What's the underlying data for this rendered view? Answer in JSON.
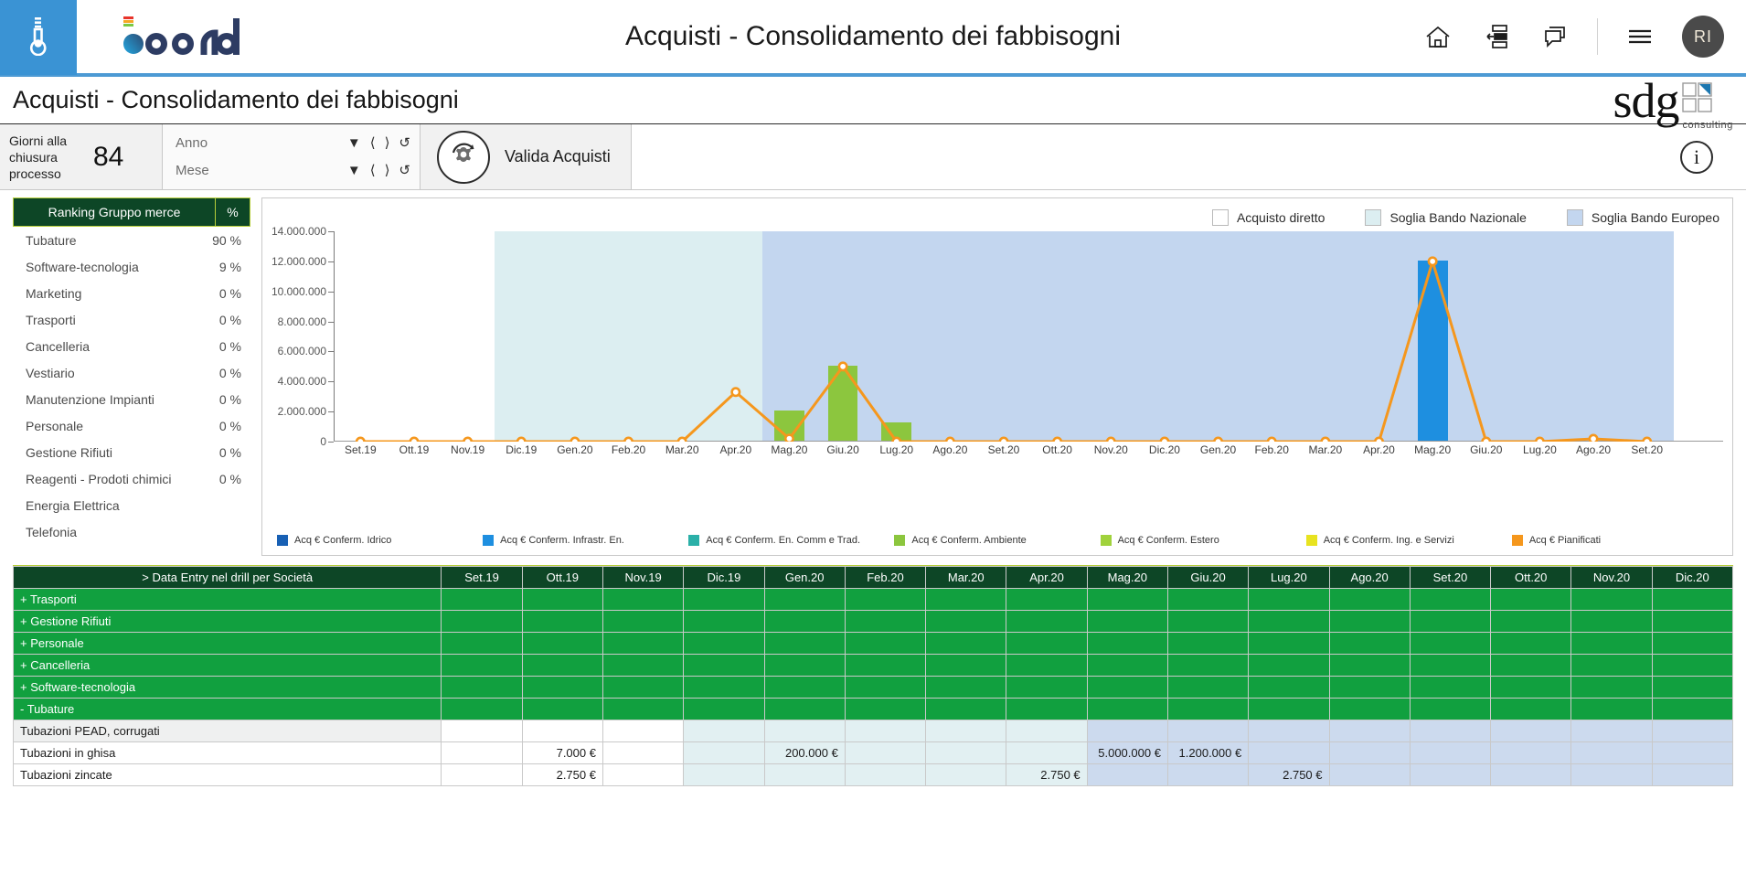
{
  "topbar": {
    "app_title": "Acquisti - Consolidamento dei fabbisogni",
    "brand": "board",
    "icons": [
      "home-icon",
      "layout-icon",
      "comments-icon",
      "hamburger-menu-icon"
    ],
    "avatar_initials": "RI"
  },
  "page_header": {
    "title": "Acquisti - Consolidamento dei fabbisogni",
    "logo_word": "sdg",
    "logo_sub": "consulting"
  },
  "filterbar": {
    "kpi_label": "Giorni alla chiusura processo",
    "kpi_value": "84",
    "selectors": [
      {
        "label": "Anno",
        "value": ""
      },
      {
        "label": "Mese",
        "value": ""
      }
    ],
    "validate_label": "Valida Acquisti",
    "info_glyph": "i"
  },
  "ranking": {
    "header_name": "Ranking Gruppo merce",
    "header_pct": "%",
    "rows": [
      {
        "name": "Tubature",
        "pct": "90 %"
      },
      {
        "name": "Software-tecnologia",
        "pct": "9 %"
      },
      {
        "name": "Marketing",
        "pct": "0 %"
      },
      {
        "name": "Trasporti",
        "pct": "0 %"
      },
      {
        "name": "Cancelleria",
        "pct": "0 %"
      },
      {
        "name": "Vestiario",
        "pct": "0 %"
      },
      {
        "name": "Manutenzione Impianti",
        "pct": "0 %"
      },
      {
        "name": "Personale",
        "pct": "0 %"
      },
      {
        "name": "Gestione Rifiuti",
        "pct": "0 %"
      },
      {
        "name": "Reagenti - Prodoti chimici",
        "pct": "0 %"
      },
      {
        "name": "Energia Elettrica",
        "pct": ""
      },
      {
        "name": "Telefonia",
        "pct": ""
      }
    ]
  },
  "chart_data": {
    "type": "bar",
    "title": "",
    "xlabel": "",
    "ylabel": "",
    "ylim": [
      0,
      14000000
    ],
    "ytick_labels": [
      "0",
      "2.000.000",
      "4.000.000",
      "6.000.000",
      "8.000.000",
      "10.000.000",
      "12.000.000",
      "14.000.000"
    ],
    "ytick_values": [
      0,
      2000000,
      4000000,
      6000000,
      8000000,
      10000000,
      12000000,
      14000000
    ],
    "grid": false,
    "legend_position": "bottom",
    "categories": [
      "Set.19",
      "Ott.19",
      "Nov.19",
      "Dic.19",
      "Gen.20",
      "Feb.20",
      "Mar.20",
      "Apr.20",
      "Mag.20",
      "Giu.20",
      "Lug.20",
      "Ago.20",
      "Set.20",
      "Ott.20",
      "Nov.20",
      "Dic.20",
      "Gen.20",
      "Feb.20",
      "Mar.20",
      "Apr.20",
      "Mag.20",
      "Giu.20",
      "Lug.20",
      "Ago.20",
      "Set.20"
    ],
    "legend_top": [
      {
        "label": "Acquisto diretto",
        "color": "#ffffff"
      },
      {
        "label": "Soglia Bando Nazionale",
        "color": "#dceef1"
      },
      {
        "label": "Soglia Bando Europeo",
        "color": "#c3d6ef"
      }
    ],
    "series": [
      {
        "name": "Acq € Conferm. Idrico",
        "color": "#1860b4",
        "values": [
          0,
          0,
          0,
          0,
          0,
          0,
          0,
          0,
          0,
          0,
          0,
          0,
          0,
          0,
          0,
          0,
          0,
          0,
          0,
          0,
          0,
          0,
          0,
          0,
          0
        ]
      },
      {
        "name": "Acq € Conferm. Infrastr. En.",
        "color": "#1e8fe0",
        "values": [
          0,
          0,
          0,
          0,
          0,
          0,
          0,
          0,
          0,
          0,
          0,
          0,
          0,
          0,
          0,
          0,
          0,
          0,
          0,
          0,
          12000000,
          0,
          0,
          0,
          0
        ]
      },
      {
        "name": "Acq € Conferm. En. Comm e Trad.",
        "color": "#2bb0a8",
        "values": [
          0,
          0,
          0,
          0,
          0,
          0,
          0,
          0,
          0,
          0,
          0,
          0,
          0,
          0,
          0,
          0,
          0,
          0,
          0,
          0,
          0,
          0,
          0,
          0,
          0
        ]
      },
      {
        "name": "Acq € Conferm. Ambiente",
        "color": "#8cc63e",
        "values": [
          0,
          0,
          0,
          0,
          0,
          0,
          0,
          0,
          2000000,
          5000000,
          1200000,
          0,
          0,
          0,
          0,
          0,
          0,
          0,
          0,
          0,
          0,
          0,
          0,
          0,
          0
        ]
      },
      {
        "name": "Acq € Conferm. Estero",
        "color": "#a0d23c",
        "values": [
          0,
          0,
          0,
          0,
          0,
          0,
          0,
          0,
          0,
          0,
          0,
          0,
          0,
          0,
          0,
          0,
          0,
          0,
          0,
          0,
          0,
          0,
          0,
          0,
          0
        ]
      },
      {
        "name": "Acq € Conferm. Ing. e Servizi",
        "color": "#e8e320",
        "values": [
          0,
          0,
          0,
          0,
          0,
          0,
          0,
          0,
          0,
          0,
          0,
          0,
          0,
          0,
          0,
          0,
          0,
          0,
          0,
          0,
          0,
          0,
          0,
          0,
          0
        ]
      },
      {
        "name": "Acq € Pianificati",
        "color": "#f5971d",
        "kind": "line",
        "values": [
          0,
          0,
          0,
          0,
          0,
          0,
          0,
          3300000,
          200000,
          5000000,
          0,
          0,
          0,
          0,
          0,
          0,
          0,
          0,
          0,
          0,
          12000000,
          0,
          0,
          180000,
          0
        ]
      }
    ],
    "bands": [
      {
        "name": "Soglia Bando Nazionale",
        "color": "#dceef1",
        "from_index": 3,
        "to_index": 7
      },
      {
        "name": "Soglia Bando Europeo",
        "color": "#c3d6ef",
        "from_index": 8,
        "to_index": 24
      }
    ]
  },
  "grid": {
    "header_first": "> Data Entry nel drill per Società",
    "columns": [
      "Set.19",
      "Ott.19",
      "Nov.19",
      "Dic.19",
      "Gen.20",
      "Feb.20",
      "Mar.20",
      "Apr.20",
      "Mag.20",
      "Giu.20",
      "Lug.20",
      "Ago.20",
      "Set.20",
      "Ott.20",
      "Nov.20",
      "Dic.20"
    ],
    "rows": [
      {
        "type": "group",
        "label": "+ Trasporti",
        "cells": [
          "",
          "",
          "",
          "",
          "",
          "",
          "",
          "",
          "",
          "",
          "",
          "",
          "",
          "",
          "",
          ""
        ]
      },
      {
        "type": "group",
        "label": "+ Gestione Rifiuti",
        "cells": [
          "",
          "",
          "",
          "",
          "",
          "",
          "",
          "",
          "",
          "",
          "",
          "",
          "",
          "",
          "",
          ""
        ]
      },
      {
        "type": "group",
        "label": "+ Personale",
        "cells": [
          "",
          "",
          "",
          "",
          "",
          "",
          "",
          "",
          "",
          "",
          "",
          "",
          "",
          "",
          "",
          ""
        ]
      },
      {
        "type": "group",
        "label": "+ Cancelleria",
        "cells": [
          "",
          "",
          "",
          "",
          "",
          "",
          "",
          "",
          "",
          "",
          "",
          "",
          "",
          "",
          "",
          ""
        ]
      },
      {
        "type": "group",
        "label": "+ Software-tecnologia",
        "cells": [
          "",
          "",
          "",
          "",
          "",
          "",
          "",
          "",
          "",
          "",
          "",
          "",
          "",
          "",
          "",
          ""
        ]
      },
      {
        "type": "group",
        "label": "- Tubature",
        "cells": [
          "",
          "",
          "",
          "",
          "",
          "",
          "",
          "",
          "",
          "",
          "",
          "",
          "",
          "",
          "",
          ""
        ]
      },
      {
        "type": "leaf",
        "alt": true,
        "label": "Tubazioni PEAD, corrugati",
        "cells": [
          "",
          "",
          "",
          "",
          "",
          "",
          "",
          "",
          "",
          "",
          "",
          "",
          "",
          "",
          "",
          ""
        ]
      },
      {
        "type": "leaf",
        "alt": false,
        "label": "Tubazioni in ghisa",
        "cells": [
          "",
          "7.000 €",
          "",
          "",
          "200.000 €",
          "",
          "",
          "",
          "5.000.000 €",
          "1.200.000 €",
          "",
          "",
          "",
          "",
          "",
          ""
        ]
      },
      {
        "type": "leaf",
        "alt": false,
        "label": "Tubazioni zincate",
        "cells": [
          "",
          "2.750 €",
          "",
          "",
          "",
          "",
          "",
          "2.750 €",
          "",
          "",
          "2.750 €",
          "",
          "",
          "",
          "",
          ""
        ]
      }
    ]
  }
}
